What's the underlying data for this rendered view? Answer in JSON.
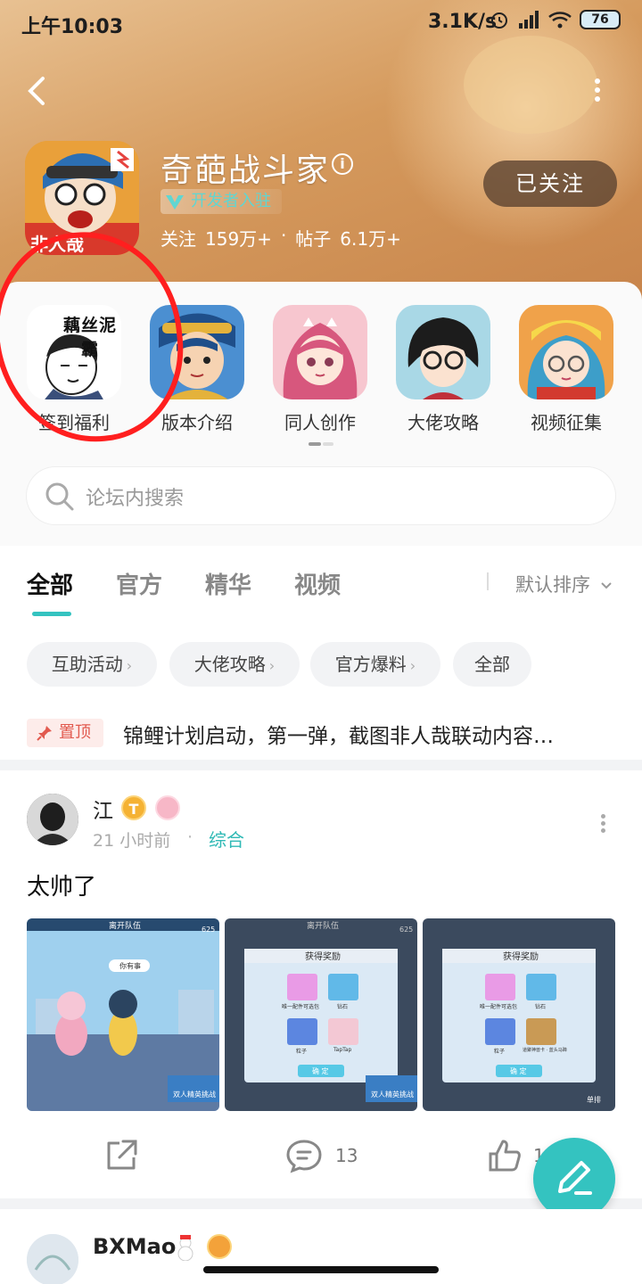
{
  "status_bar": {
    "time": "上午10:03",
    "speed": "3.1K/s",
    "battery": "76"
  },
  "header": {
    "title": "奇葩战斗家",
    "info_symbol": "i",
    "dev_badge": "开发者入驻",
    "stats": {
      "follow_label": "关注",
      "follow_count": "159万+",
      "dot": "·",
      "posts_label": "帖子",
      "posts_count": "6.1万+"
    },
    "follow_button": "已关注",
    "icon_text": "非人哉"
  },
  "shortcuts": [
    {
      "label": "签到福利",
      "thumb_text": "藕丝泥霸"
    },
    {
      "label": "版本介绍"
    },
    {
      "label": "同人创作"
    },
    {
      "label": "大佬攻略"
    },
    {
      "label": "视频征集"
    }
  ],
  "search": {
    "placeholder": "论坛内搜索"
  },
  "tabs": [
    {
      "label": "全部",
      "active": true
    },
    {
      "label": "官方",
      "active": false
    },
    {
      "label": "精华",
      "active": false
    },
    {
      "label": "视频",
      "active": false
    }
  ],
  "sort": {
    "label": "默认排序"
  },
  "chips": [
    {
      "label": "互助活动",
      "arrow": "›"
    },
    {
      "label": "大佬攻略",
      "arrow": "›"
    },
    {
      "label": "官方爆料",
      "arrow": "›"
    },
    {
      "label": "全部",
      "arrow": ""
    }
  ],
  "pinned": {
    "tag": "置顶",
    "text": "锦鲤计划启动，第一弹，截图非人哉联动内容…"
  },
  "post": {
    "author": "江",
    "badge_t": "T",
    "time": "21 小时前",
    "sep": "·",
    "category": "综合",
    "body": "太帅了",
    "screenshots": [
      {
        "top_label": "离开队伍",
        "score": "625",
        "speech": "你有事",
        "banner": "双人精英挑战"
      },
      {
        "top_label": "离开队伍",
        "score": "625",
        "dialog_title": "获得奖励",
        "items": [
          "唯一配件可选包",
          "钻石",
          "粒子",
          "TapTap"
        ],
        "confirm": "确 定",
        "banner": "双人精英挑战"
      },
      {
        "dialog_title": "获得奖励",
        "items": [
          "唯一配件可选包",
          "钻石",
          "粒子",
          "道聚神兽卡 · 蓝头马蹄"
        ],
        "confirm": "确 定",
        "banner": "单排"
      }
    ],
    "comment_count": "13",
    "like_count": "1"
  },
  "post2": {
    "author": "BXMao"
  },
  "colors": {
    "accent": "#34c3c0",
    "pin": "#e25a4f",
    "annotation": "#ff1f1f"
  }
}
